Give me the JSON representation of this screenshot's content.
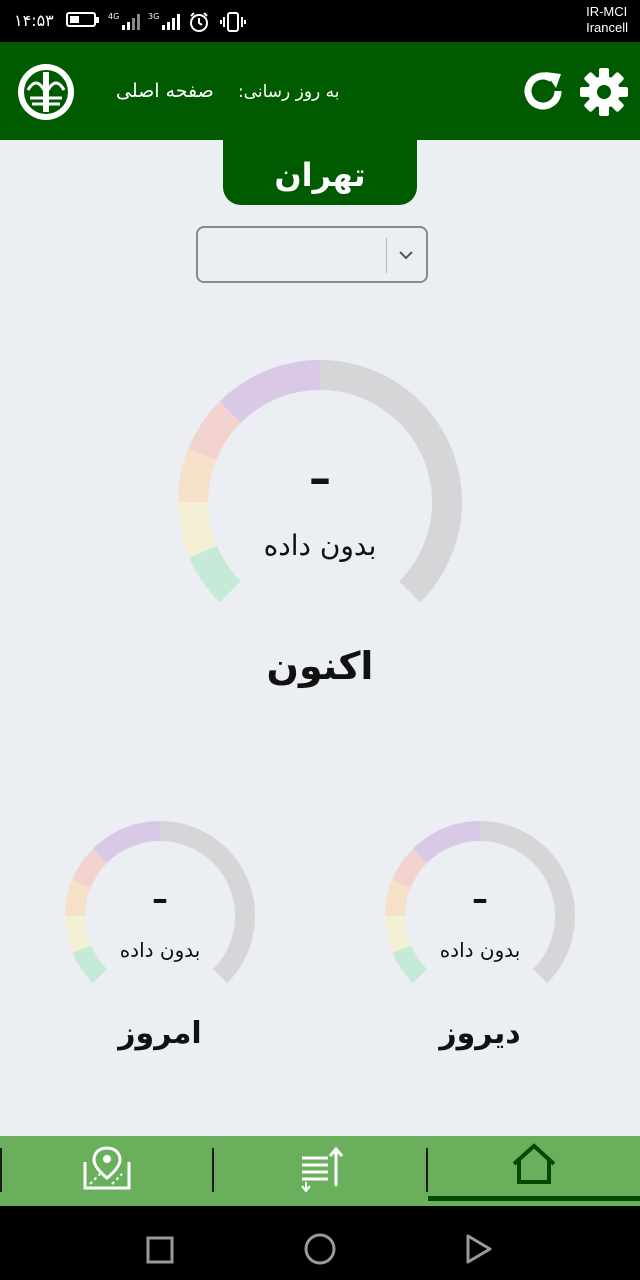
{
  "status_bar": {
    "time": "۱۴:۵۳",
    "network_1": "4G",
    "network_2": "3G",
    "carrier_1": "IR-MCI",
    "carrier_2": "Irancell"
  },
  "header": {
    "update_label": "به روز رسانی:",
    "page_title": "صفحه اصلی",
    "refresh_icon": "refresh-icon",
    "settings_icon": "gear-icon"
  },
  "city": {
    "name": "تهران"
  },
  "select": {
    "value": ""
  },
  "gauges": {
    "now": {
      "value": "–",
      "text": "بدون داده",
      "label": "اکنون"
    },
    "today": {
      "value": "–",
      "text": "بدون داده",
      "label": "امروز"
    },
    "yesterday": {
      "value": "–",
      "text": "بدون داده",
      "label": "دیروز"
    }
  },
  "gauge_colors": [
    "#c5ead8",
    "#f4f0d6",
    "#f6e0c8",
    "#f3d3d0",
    "#dac9e6",
    "#d6d6d8"
  ],
  "bottom_nav": {
    "items": [
      {
        "name": "map-icon"
      },
      {
        "name": "sort-icon"
      },
      {
        "name": "home-icon",
        "active": true
      }
    ]
  },
  "theme": {
    "primary": "#005a00",
    "nav": "#6aaf5c",
    "background": "#ebeef3"
  }
}
